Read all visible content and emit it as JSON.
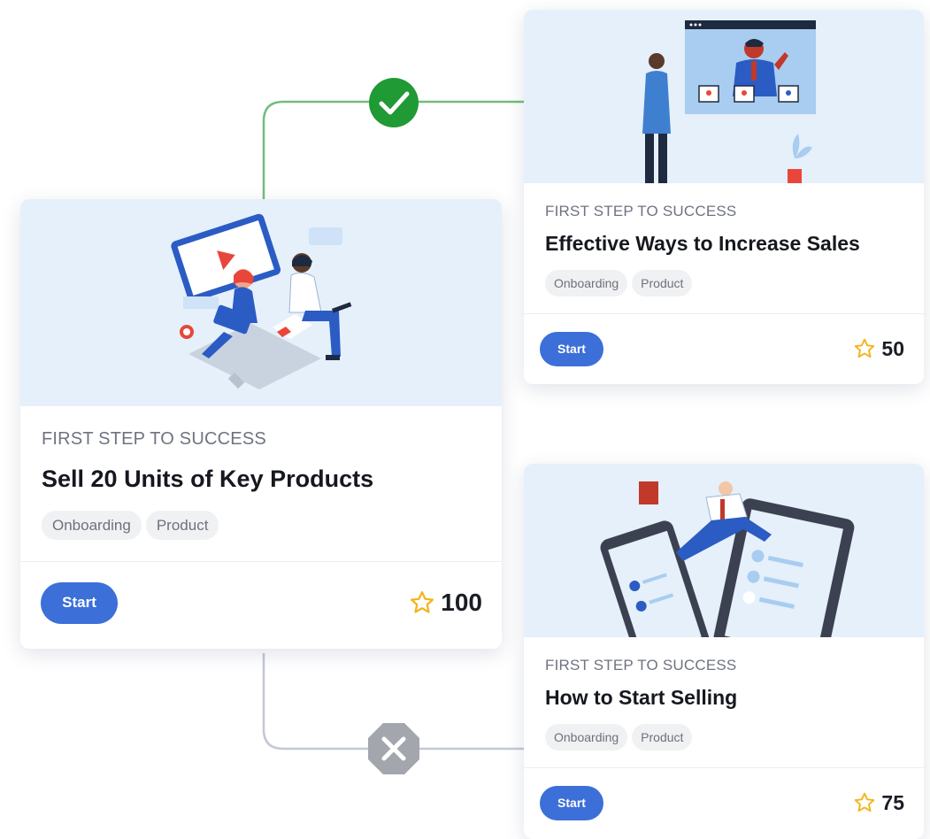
{
  "colors": {
    "accent": "#3c6fd8",
    "success": "#1f9a34",
    "success_line": "#73bd7c",
    "fail": "#a3a6ad",
    "fail_line": "#c3c8d8",
    "star": "#f3b51c",
    "illustration_bg": "#e5f0fb"
  },
  "connectors": {
    "success_icon": "check-icon",
    "fail_icon": "close-icon"
  },
  "cards": [
    {
      "eyebrow": "FIRST STEP TO SUCCESS",
      "title": "Sell 20 Units of Key Products",
      "tags": [
        "Onboarding",
        "Product"
      ],
      "button": "Start",
      "points": "100",
      "illustration": "people-with-laptop-and-video-screen"
    },
    {
      "eyebrow": "FIRST STEP TO SUCCESS",
      "title": "Effective Ways to Increase Sales",
      "tags": [
        "Onboarding",
        "Product"
      ],
      "button": "Start",
      "points": "50",
      "illustration": "man-watching-video-call-screen"
    },
    {
      "eyebrow": "FIRST STEP TO SUCCESS",
      "title": "How to Start Selling",
      "tags": [
        "Onboarding",
        "Product"
      ],
      "button": "Start",
      "points": "75",
      "illustration": "man-jumping-between-phone-and-tablet"
    }
  ]
}
